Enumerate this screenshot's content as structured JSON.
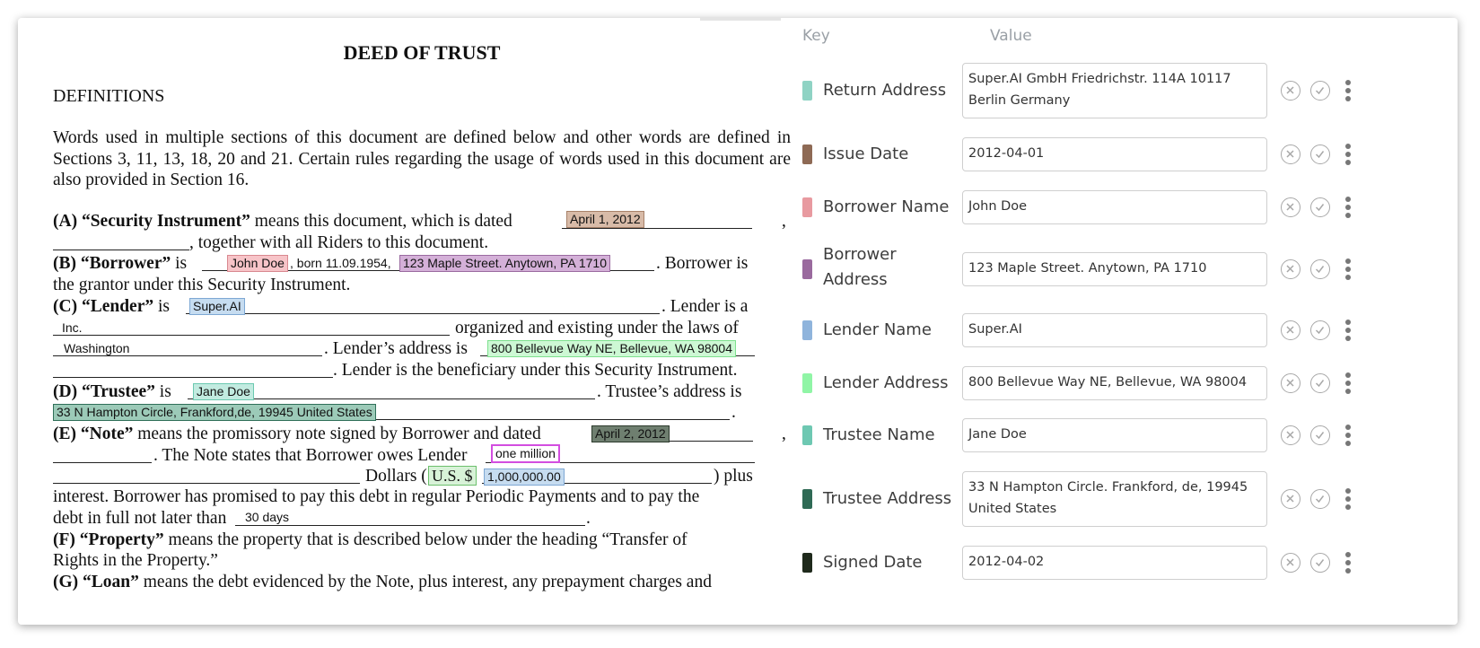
{
  "document": {
    "title": "DEED OF TRUST",
    "section_heading": "DEFINITIONS",
    "intro": "Words used in multiple sections of this document are defined below and other words are defined in Sections 3, 11, 13, 18, 20 and 21.  Certain rules regarding the usage of words used in this document are also provided in Section 16.",
    "A_label": "(A) “Security Instrument”",
    "A_text": " means this document, which is dated ",
    "A_date": "April 1, 2012",
    "A_comma": ",",
    "A_text2": ", together with all Riders to this document.",
    "B_label": "(B) “Borrower”",
    "B_is": " is ",
    "B_name": "John Doe",
    "B_born": ", born 11.09.1954, ",
    "B_address": "123 Maple Street. Anytown, PA 1710",
    "B_text2": ".  Borrower is",
    "B_text3": "the grantor under this Security Instrument.",
    "C_label": "(C) “Lender”",
    "C_is": " is ",
    "C_name": "Super.AI",
    "C_text": ".  Lender is a",
    "C_inc": "Inc.",
    "C_text2": "organized and existing under the laws of",
    "C_state": "Washington",
    "C_text3": ".  Lender’s address is",
    "C_address": "800 Bellevue Way NE, Bellevue, WA 98004",
    "C_text4": ".  Lender is the beneficiary under this Security Instrument.",
    "D_label": "(D) “Trustee”",
    "D_is": " is ",
    "D_name": "Jane Doe",
    "D_text": ".  Trustee’s address is",
    "D_address": "33 N Hampton Circle, Frankford,de, 19945  United States",
    "D_period": ".",
    "E_label": "(E) “Note”",
    "E_text": " means the promissory note signed by Borrower and dated",
    "E_date": "April 2, 2012",
    "E_comma": ",",
    "E_text2": ".  The Note states that Borrower owes Lender",
    "E_amount_words": "one million",
    "E_dollars": "Dollars (",
    "E_currency": "U.S. $",
    "E_amount": "1,000,000.00",
    "E_plus": ") plus",
    "E_text3": "interest.  Borrower has promised to pay this debt in regular Periodic Payments and to pay the",
    "E_text4": "debt in full not later than",
    "E_term": "30 days",
    "E_period": ".",
    "F_label": "(F) “Property”",
    "F_text": " means the property that is described below under the heading “Transfer of",
    "F_text2": "Rights in the Property.”",
    "G_label": "(G) “Loan”",
    "G_text": " means the debt evidenced by the Note, plus interest, any prepayment charges and"
  },
  "panel": {
    "key_header": "Key",
    "value_header": "Value",
    "fields": [
      {
        "key": "Return Address",
        "value": "Super.AI GmbH Friedrichstr. 114A 10117 Berlin Germany",
        "color": "#8fd3c4"
      },
      {
        "key": "Issue Date",
        "value": "2012-04-01",
        "color": "#8e6a55"
      },
      {
        "key": "Borrower Name",
        "value": "John Doe",
        "color": "#e89aa0"
      },
      {
        "key": "Borrower Address",
        "value": "123 Maple Street. Anytown, PA 1710",
        "color": "#9a6a9e"
      },
      {
        "key": "Lender Name",
        "value": "Super.AI",
        "color": "#8fb4dc"
      },
      {
        "key": "Lender Address",
        "value": "800 Bellevue Way NE, Bellevue, WA 98004",
        "color": "#90f5a6"
      },
      {
        "key": "Trustee Name",
        "value": "Jane Doe",
        "color": "#6ec8b2"
      },
      {
        "key": "Trustee Address",
        "value": "33 N Hampton Circle. Frankford, de, 19945 United States",
        "color": "#2f6a55"
      },
      {
        "key": "Signed Date",
        "value": "2012-04-02",
        "color": "#1f2a1c"
      }
    ]
  }
}
